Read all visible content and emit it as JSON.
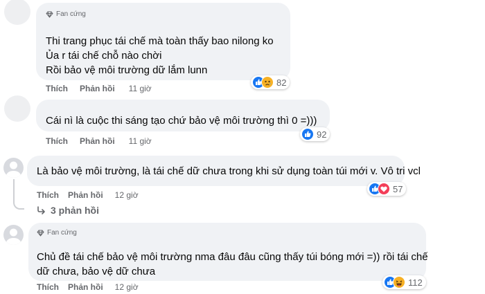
{
  "comments": [
    {
      "badge": "Fan cứng",
      "lines": [
        "Thi trang phục tái chế mà toàn thấy bao nilong ko",
        "Ủa r tái chế chỗ nào chời",
        "Rồi bảo vệ môi trường dữ lắm lunn"
      ],
      "like": "Thích",
      "reply": "Phản hồi",
      "time": "11 giờ",
      "reactions": [
        "like-icon",
        "sad-icon"
      ],
      "count": "82"
    },
    {
      "lines": [
        "Cái nì là cuộc thi sáng tạo chứ bảo vệ môi trường thì 0 =)))"
      ],
      "like": "Thích",
      "reply": "Phản hồi",
      "time": "11 giờ",
      "reactions": [
        "like-icon"
      ],
      "count": "92"
    },
    {
      "lines": [
        "Là bảo vệ môi trường, là tái chế dữ chưa trong khi sử dụng toàn túi mới v. Vô tri vcl"
      ],
      "like": "Thích",
      "reply": "Phản hồi",
      "time": "12 giờ",
      "reactions": [
        "like-icon",
        "love-icon"
      ],
      "count": "57",
      "replies": "3 phản hồi"
    },
    {
      "badge": "Fan cứng",
      "lines": [
        "Chủ đề tái chế bảo vệ môi trường nma đâu đâu cũng thấy túi bóng mới =)) rồi tái chế",
        "dữ chưa, bảo vệ dữ chưa"
      ],
      "like": "Thích",
      "reply": "Phản hồi",
      "time": "12 giờ",
      "reactions": [
        "like-icon",
        "haha-icon"
      ],
      "count": "112"
    }
  ],
  "colors": {
    "like": "#1877f2",
    "love": "#f33e58",
    "sad": "#f7b125",
    "bubble": "#f0f2f5",
    "meta": "#65676b"
  }
}
